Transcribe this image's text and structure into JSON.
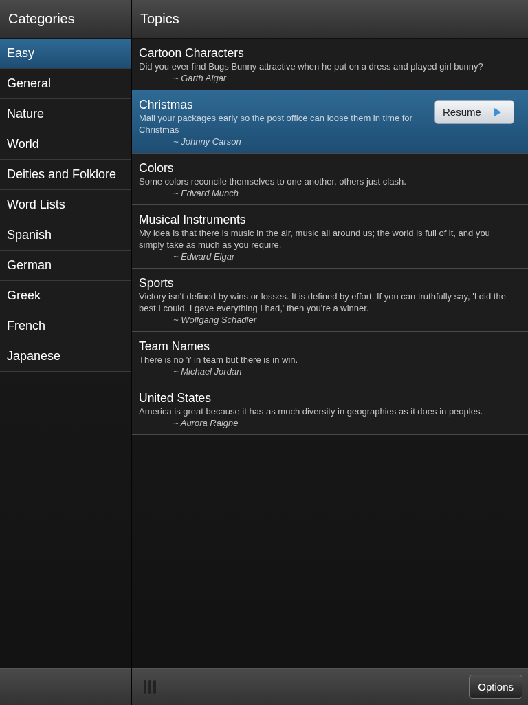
{
  "categories": {
    "title": "Categories",
    "items": [
      {
        "label": "Easy",
        "selected": true
      },
      {
        "label": "General",
        "selected": false
      },
      {
        "label": "Nature",
        "selected": false
      },
      {
        "label": "World",
        "selected": false
      },
      {
        "label": "Deities and Folklore",
        "selected": false
      },
      {
        "label": "Word Lists",
        "selected": false
      },
      {
        "label": "Spanish",
        "selected": false
      },
      {
        "label": "German",
        "selected": false
      },
      {
        "label": "Greek",
        "selected": false
      },
      {
        "label": "French",
        "selected": false
      },
      {
        "label": "Japanese",
        "selected": false
      }
    ]
  },
  "topics": {
    "title": "Topics",
    "items": [
      {
        "title": "Cartoon Characters",
        "quote": "Did you ever find Bugs Bunny attractive when he put on a dress and played girl bunny?",
        "author": "~ Garth Algar",
        "selected": false
      },
      {
        "title": "Christmas",
        "quote": "Mail your packages early so the post office can loose them in time for Christmas",
        "author": "~ Johnny Carson",
        "selected": true,
        "action": "Resume"
      },
      {
        "title": "Colors",
        "quote": "Some colors reconcile themselves to one another, others just clash.",
        "author": "~ Edvard Munch",
        "selected": false
      },
      {
        "title": "Musical Instruments",
        "quote": "My idea is that there is music in the air, music all around us; the world is full of it, and you simply take as much as you require.",
        "author": "~ Edward Elgar",
        "selected": false
      },
      {
        "title": "Sports",
        "quote": "Victory isn't defined by wins or losses. It is defined by effort. If you can truthfully say, 'I did the best I could, I gave everything I had,' then you're a winner.",
        "author": "~ Wolfgang Schadler",
        "selected": false
      },
      {
        "title": "Team Names",
        "quote": "There is no 'i' in team but there is in win.",
        "author": "~ Michael Jordan",
        "selected": false
      },
      {
        "title": "United States",
        "quote": "America is great because it has as much diversity in geographies as it does in peoples.",
        "author": "~ Aurora Raigne",
        "selected": false
      }
    ]
  },
  "toolbar": {
    "options_button": "Options"
  }
}
